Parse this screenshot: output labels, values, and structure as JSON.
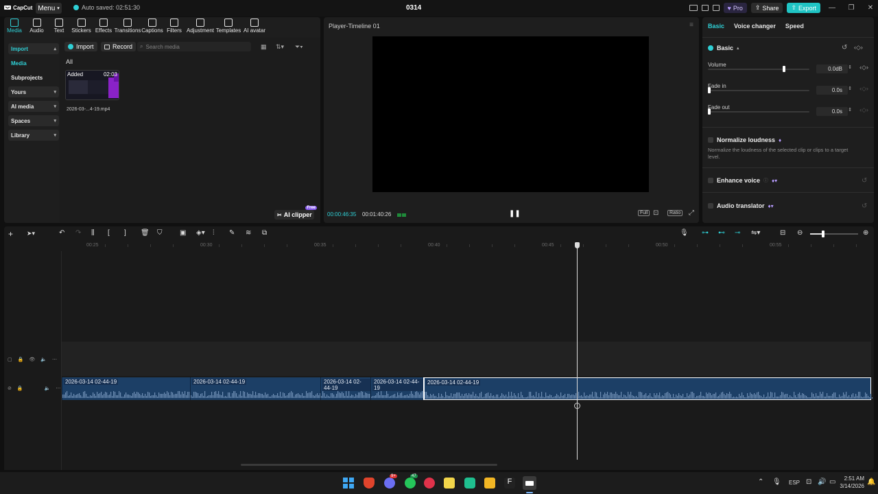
{
  "app": {
    "name": "CapCut",
    "menu_label": "Menu",
    "autosave": "Auto saved: 02:51:30",
    "project_title": "0314"
  },
  "topbar": {
    "pro_label": "Pro",
    "share_label": "Share",
    "export_label": "Export"
  },
  "toolbar": [
    {
      "label": "Media",
      "icon": "media-icon"
    },
    {
      "label": "Audio",
      "icon": "audio-icon"
    },
    {
      "label": "Text",
      "icon": "text-icon"
    },
    {
      "label": "Stickers",
      "icon": "stickers-icon"
    },
    {
      "label": "Effects",
      "icon": "effects-icon"
    },
    {
      "label": "Transitions",
      "icon": "transitions-icon"
    },
    {
      "label": "Captions",
      "icon": "captions-icon"
    },
    {
      "label": "Filters",
      "icon": "filters-icon"
    },
    {
      "label": "Adjustment",
      "icon": "adjustment-icon"
    },
    {
      "label": "Templates",
      "icon": "templates-icon"
    },
    {
      "label": "AI avatar",
      "icon": "ai-avatar-icon"
    }
  ],
  "sidebar": [
    {
      "label": "Import",
      "style": "box-accent"
    },
    {
      "label": "Media",
      "style": "accent"
    },
    {
      "label": "Subprojects",
      "style": "plain"
    },
    {
      "label": "Yours",
      "style": "box"
    },
    {
      "label": "AI media",
      "style": "box"
    },
    {
      "label": "Spaces",
      "style": "box"
    },
    {
      "label": "Library",
      "style": "box"
    }
  ],
  "media": {
    "import_label": "Import",
    "record_label": "Record",
    "search_placeholder": "Search media",
    "filter_label": "All",
    "items": [
      {
        "badge": "Added",
        "duration": "02:03",
        "name": "2026-03-...4-19.mp4"
      }
    ],
    "ai_clipper_label": "AI clipper",
    "ai_clipper_badge": "Free"
  },
  "player": {
    "title": "Player-Timeline 01",
    "current_time": "00:00:46:35",
    "total_time": "00:01:40:26",
    "full_label": "Full",
    "ratio_label": "Ratio"
  },
  "inspector": {
    "tabs": [
      "Basic",
      "Voice changer",
      "Speed"
    ],
    "basic_section": "Basic",
    "volume": {
      "label": "Volume",
      "value": "0.0dB",
      "level": 0.75
    },
    "fade_in": {
      "label": "Fade in",
      "value": "0.0s",
      "level": 0.0
    },
    "fade_out": {
      "label": "Fade out",
      "value": "0.0s",
      "level": 0.0
    },
    "normalize": {
      "label": "Normalize loudness",
      "desc": "Normalize the loudness of the selected clip or clips to a target level."
    },
    "enhance_voice": {
      "label": "Enhance voice"
    },
    "audio_translator": {
      "label": "Audio translator"
    }
  },
  "timeline": {
    "ruler": [
      "00:25",
      "00:30",
      "00:35",
      "00:40",
      "00:45",
      "00:50",
      "00:55"
    ],
    "clips": [
      {
        "label": "2026-03-14 02-44-19"
      },
      {
        "label": "2026-03-14 02-44-19"
      },
      {
        "label": "2026-03-14 02-44-19"
      },
      {
        "label": "2026-03-14 02-44-19"
      },
      {
        "label": "2026-03-14 02-44-19"
      }
    ]
  },
  "taskbar": {
    "language": "ESP",
    "time": "2:51 AM",
    "date": "3/14/2026",
    "badges": [
      "9+",
      "47"
    ]
  },
  "colors": {
    "accent": "#2fd0d6",
    "clip": "#1c3f66",
    "pro": "#b79cff"
  }
}
